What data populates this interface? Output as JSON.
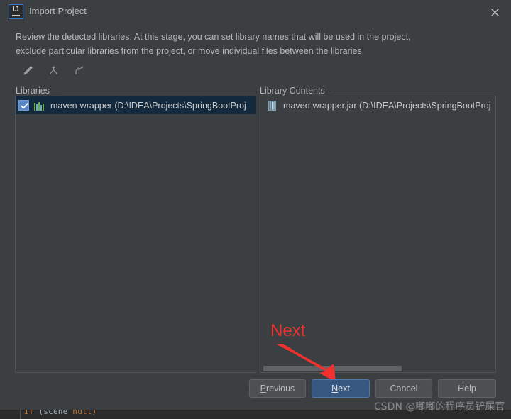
{
  "window": {
    "title": "Import Project",
    "logo_text": "IJ",
    "close_icon": "close-icon"
  },
  "description": {
    "line1": "Review the detected libraries. At this stage, you can set library names that will be used in the project,",
    "line2": "exclude particular libraries from the project, or move individual files between the libraries."
  },
  "toolbar": {
    "items": [
      {
        "name": "edit-icon",
        "tooltip": "Edit"
      },
      {
        "name": "merge-icon",
        "tooltip": "Merge"
      },
      {
        "name": "split-icon",
        "tooltip": "Split"
      }
    ]
  },
  "libraries_panel": {
    "label": "Libraries",
    "rows": [
      {
        "checked": true,
        "icon": "library-icon",
        "label": "maven-wrapper (D:\\IDEA\\Projects\\SpringBootProj",
        "selected": true
      }
    ]
  },
  "library_contents_panel": {
    "label": "Library Contents",
    "rows": [
      {
        "icon": "jar-file-icon",
        "label": "maven-wrapper.jar (D:\\IDEA\\Projects\\SpringBootProj",
        "selected": false
      }
    ],
    "scrollbar": {
      "thumb_percent": 59
    }
  },
  "annotation": {
    "text": "Next",
    "color": "#f0312e",
    "arrow": "arrow-pointing-to-next-button"
  },
  "buttons": [
    {
      "id": "previous",
      "label": "Previous",
      "mnemonic": "P",
      "primary": false
    },
    {
      "id": "next",
      "label": "Next",
      "mnemonic": "N",
      "primary": true
    },
    {
      "id": "cancel",
      "label": "Cancel",
      "mnemonic": "",
      "primary": false
    },
    {
      "id": "help",
      "label": "Help",
      "mnemonic": "",
      "primary": false
    }
  ],
  "watermark": {
    "text": "CSDN @嘟嘟的程序员铲屎官"
  },
  "backdrop": {
    "code_prefix": "if",
    "code_mid": "(scene",
    "code_suffix": "null)"
  },
  "colors": {
    "dialog_bg": "#3c3f41",
    "ide_bg": "#2b2b2b",
    "selection_bg": "#13293d",
    "checkbox_blue": "#5a87c7",
    "primary_button": "#365880",
    "annotation_red": "#f0312e",
    "text": "#bbbbbb"
  }
}
